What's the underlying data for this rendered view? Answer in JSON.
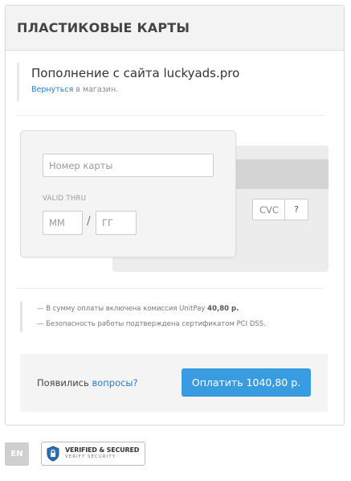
{
  "header": {
    "title": "ПЛАСТИКОВЫЕ КАРТЫ"
  },
  "merchant": {
    "name": "Пополнение с сайта luckyads.pro",
    "back_link": "Вернуться",
    "back_suffix": " в магазин."
  },
  "card": {
    "number_placeholder": "Номер карты",
    "valid_thru_label": "VALID THRU",
    "month_placeholder": "ММ",
    "year_placeholder": "ГГ",
    "slash": "/",
    "cvc_placeholder": "CVC",
    "cvc_help": "?"
  },
  "notes": {
    "commission_prefix": "— В сумму оплаты включена комиссия UnitPay ",
    "commission_amount": "40,80 р.",
    "security": "— Безопасность работы подтверждена сертификатом PCI DSS."
  },
  "footer": {
    "question_prefix": "Появились ",
    "question_link": "вопросы?",
    "pay_button": "Оплатить 1040,80 р."
  },
  "bottom": {
    "language": "EN",
    "badge_line1": "VERIFIED & SECURED",
    "badge_line2": "VERIFY SECURITY",
    "badge_icon": "lock-shield-icon"
  },
  "colors": {
    "accent": "#399ce0",
    "link": "#2b7bc3",
    "header_bg": "#f3f3f3"
  }
}
